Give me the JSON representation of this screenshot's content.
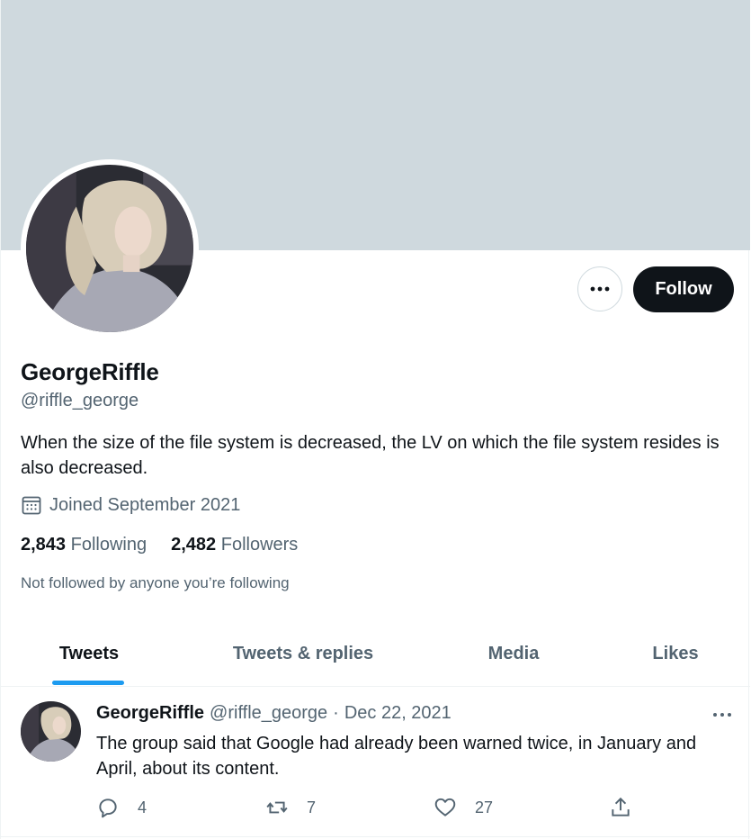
{
  "profile": {
    "display_name": "GeorgeRiffle",
    "handle": "@riffle_george",
    "bio": "When the size of the file system is decreased, the LV on which the file system resides is also decreased.",
    "joined": "Joined September 2021",
    "following_count": "2,843",
    "following_label": "Following",
    "followers_count": "2,482",
    "followers_label": "Followers",
    "not_followed_text": "Not followed by anyone you’re following"
  },
  "buttons": {
    "follow_label": "Follow",
    "more_icon": "more-horizontal-icon"
  },
  "tabs": [
    {
      "label": "Tweets",
      "active": true
    },
    {
      "label": "Tweets & replies",
      "active": false
    },
    {
      "label": "Media",
      "active": false
    },
    {
      "label": "Likes",
      "active": false
    }
  ],
  "tweet": {
    "name": "GeorgeRiffle",
    "handle": "@riffle_george",
    "separator": "·",
    "date": "Dec 22, 2021",
    "text": "The group said that Google had already been warned twice, in January and April, about its content.",
    "replies": "4",
    "retweets": "7",
    "likes": "27"
  },
  "colors": {
    "banner": "#cfd9de",
    "accent": "#1d9bf0",
    "text_primary": "#0f1419",
    "text_secondary": "#536471",
    "follow_bg": "#0f1419"
  }
}
